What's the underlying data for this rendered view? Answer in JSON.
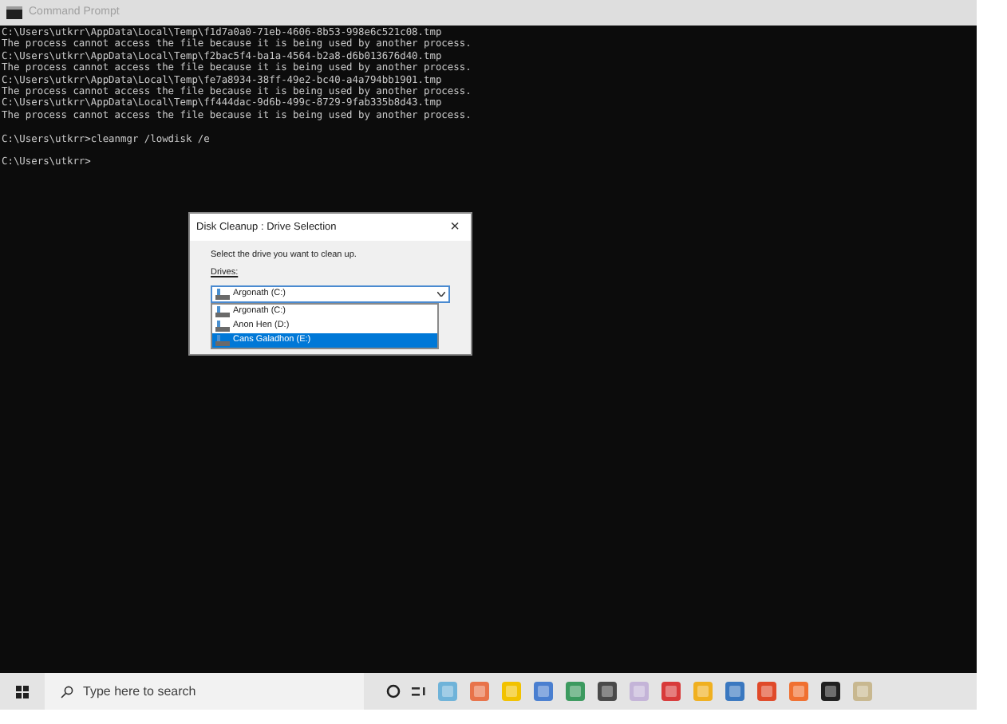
{
  "window": {
    "title": "Command Prompt"
  },
  "console_blocks": [
    [
      "C:\\Users\\utkrr\\AppData\\Local\\Temp\\f1d7a0a0-71eb-4606-8b53-998e6c521c08.tmp",
      "The process cannot access the file because it is being used by another process.",
      "C:\\Users\\utkrr\\AppData\\Local\\Temp\\f2bac5f4-ba1a-4564-b2a8-d6b013676d40.tmp",
      "The process cannot access the file because it is being used by another process.",
      "C:\\Users\\utkrr\\AppData\\Local\\Temp\\fe7a8934-38ff-49e2-bc40-a4a794bb1901.tmp",
      "The process cannot access the file because it is being used by another process.",
      "C:\\Users\\utkrr\\AppData\\Local\\Temp\\ff444dac-9d6b-499c-8729-9fab335b8d43.tmp",
      "The process cannot access the file because it is being used by another process."
    ],
    [
      "C:\\Users\\utkrr>cleanmgr /lowdisk /e"
    ],
    [
      "C:\\Users\\utkrr>"
    ]
  ],
  "dialog": {
    "title": "Disk Cleanup : Drive Selection",
    "close": "×",
    "prompt": "Select the drive you want to clean up.",
    "drives_label": "Drives:",
    "combo_value": "Argonath (C:)",
    "options": [
      {
        "label": "Argonath (C:)",
        "selected": false
      },
      {
        "label": "Anon Hen (D:)",
        "selected": false
      },
      {
        "label": "Cans Galadhon (E:)",
        "selected": true
      }
    ]
  },
  "taskbar": {
    "search_placeholder": "Type here to search"
  }
}
